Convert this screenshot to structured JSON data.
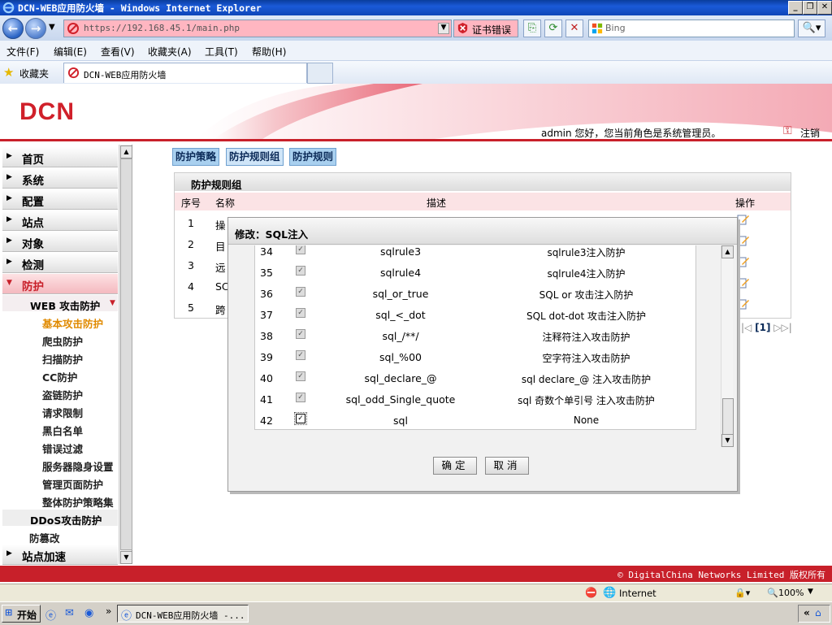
{
  "window": {
    "title": "DCN-WEB应用防火墙 - Windows Internet Explorer"
  },
  "browser": {
    "url": "https://192.168.45.1/main.php",
    "cert_error": "证书错误",
    "search_engine": "Bing",
    "menu": [
      "文件(F)",
      "编辑(E)",
      "查看(V)",
      "收藏夹(A)",
      "工具(T)",
      "帮助(H)"
    ],
    "favorites_label": "收藏夹",
    "tab_title": "DCN-WEB应用防火墙",
    "status_zone": "Internet",
    "zoom": "100%"
  },
  "app": {
    "logo": "DCN",
    "user_greeting": "admin 您好，您当前角色是系统管理员。",
    "logout": "注销",
    "footer": "© DigitalChina Networks Limited 版权所有"
  },
  "sidebar": {
    "items": [
      "首页",
      "系统",
      "配置",
      "站点",
      "对象",
      "检测",
      "防护"
    ],
    "active": "防护",
    "web_sub": "WEB 攻击防护",
    "web_children": [
      "基本攻击防护",
      "爬虫防护",
      "扫描防护",
      "CC防护",
      "盗链防护",
      "请求限制",
      "黑白名单",
      "错误过滤",
      "服务器隐身设置",
      "管理页面防护",
      "整体防护策略集"
    ],
    "selected_child": "基本攻击防护",
    "ddos": "DDoS攻击防护",
    "tamper": "防篡改",
    "bottom_item": "站点加速"
  },
  "main": {
    "tabs": [
      "防护策略",
      "防护规则组",
      "防护规则"
    ],
    "active_tab": "防护规则组",
    "panel_title": "防护规则组",
    "columns": [
      "序号",
      "名称",
      "描述",
      "操作"
    ],
    "rows": [
      {
        "num": "1",
        "name": "操"
      },
      {
        "num": "2",
        "name": "目"
      },
      {
        "num": "3",
        "name": "远"
      },
      {
        "num": "4",
        "name": "SC"
      },
      {
        "num": "5",
        "name": "跨"
      }
    ],
    "pager": "[1]"
  },
  "modal": {
    "title": "修改：SQL注入",
    "rules": [
      {
        "num": "34",
        "name": "sqlrule3",
        "desc": "sqlrule3注入防护",
        "checked": true,
        "disabled": true
      },
      {
        "num": "35",
        "name": "sqlrule4",
        "desc": "sqlrule4注入防护",
        "checked": true,
        "disabled": true
      },
      {
        "num": "36",
        "name": "sql_or_true",
        "desc": "SQL or 攻击注入防护",
        "checked": true,
        "disabled": true
      },
      {
        "num": "37",
        "name": "sql_<_dot",
        "desc": "SQL dot-dot 攻击注入防护",
        "checked": true,
        "disabled": true
      },
      {
        "num": "38",
        "name": "sql_/**/",
        "desc": "注释符注入攻击防护",
        "checked": true,
        "disabled": true
      },
      {
        "num": "39",
        "name": "sql_%00",
        "desc": "空字符注入攻击防护",
        "checked": true,
        "disabled": true
      },
      {
        "num": "40",
        "name": "sql_declare_@",
        "desc": "sql declare_@ 注入攻击防护",
        "checked": true,
        "disabled": true
      },
      {
        "num": "41",
        "name": "sql_odd_Single_quote",
        "desc": "sql 奇数个单引号 注入攻击防护",
        "checked": true,
        "disabled": true
      },
      {
        "num": "42",
        "name": "sql",
        "desc": "None",
        "checked": true,
        "disabled": false
      }
    ],
    "ok_label": "确定",
    "cancel_label": "取消"
  },
  "taskbar": {
    "start": "开始",
    "task": "DCN-WEB应用防火墙 -..."
  }
}
